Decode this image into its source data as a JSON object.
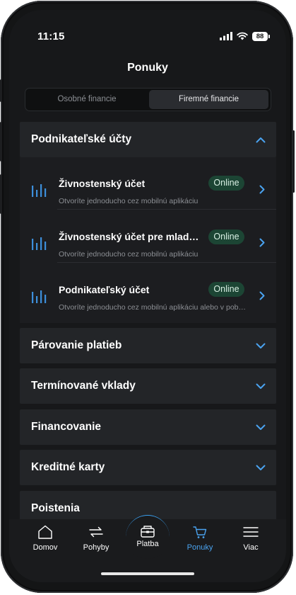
{
  "status_bar": {
    "time": "11:15",
    "battery": "88"
  },
  "header": {
    "title": "Ponuky"
  },
  "tabs": [
    {
      "label": "Osobné financie",
      "active": false
    },
    {
      "label": "Firemné financie",
      "active": true
    }
  ],
  "sections": {
    "expanded": {
      "title": "Podnikateľské účty",
      "accounts": [
        {
          "name": "Živnostenský účet",
          "badge": "Online",
          "description": "Otvoríte jednoducho cez mobilnú aplikáciu"
        },
        {
          "name": "Živnostenský účet pre mladých",
          "badge": "Online",
          "description": "Otvoríte jednoducho cez mobilnú aplikáciu"
        },
        {
          "name": "Podnikateľský účet",
          "badge": "Online",
          "description": "Otvoríte jednoducho cez mobilnú aplikáciu alebo v pobočke"
        }
      ]
    },
    "collapsed": [
      {
        "title": "Párovanie platieb"
      },
      {
        "title": "Termínované vklady"
      },
      {
        "title": "Financovanie"
      },
      {
        "title": "Kreditné karty"
      },
      {
        "title": "Poistenia"
      }
    ]
  },
  "bottom_nav": [
    {
      "label": "Domov",
      "icon": "home-icon"
    },
    {
      "label": "Pohyby",
      "icon": "transfer-arrows-icon"
    },
    {
      "label": "Platba",
      "icon": "wallet-icon"
    },
    {
      "label": "Ponuky",
      "icon": "cart-icon",
      "active": true
    },
    {
      "label": "Viac",
      "icon": "menu-icon"
    }
  ],
  "colors": {
    "accent": "#4aa3f0",
    "badge_bg": "#1c4534",
    "card_bg": "#232528",
    "screen_bg": "#17181a"
  }
}
